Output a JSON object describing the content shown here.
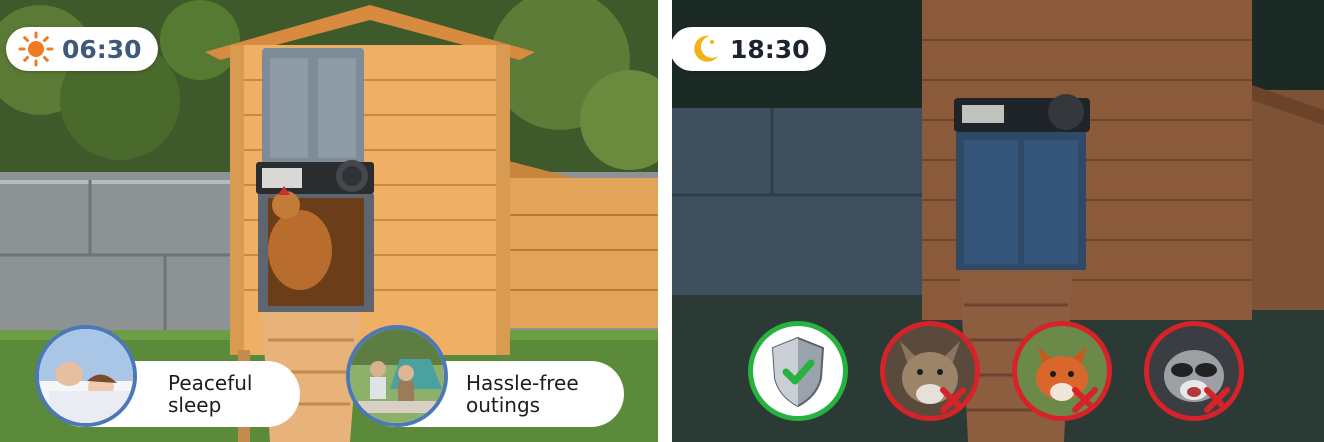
{
  "day_panel": {
    "time": "06:30",
    "time_icon": "sun-icon",
    "features": [
      {
        "label": "Peaceful\nsleep",
        "icon": "sleeping-couple-photo"
      },
      {
        "label": "Hassle-free\noutings",
        "icon": "family-picnic-photo"
      }
    ]
  },
  "night_panel": {
    "time": "18:30",
    "time_icon": "moon-icon",
    "badges": [
      {
        "name": "shield-check",
        "status": "allowed"
      },
      {
        "name": "wolf",
        "status": "blocked"
      },
      {
        "name": "fox",
        "status": "blocked"
      },
      {
        "name": "raccoon",
        "status": "blocked"
      }
    ]
  },
  "colors": {
    "time_day": "#3d5a7a",
    "sun": "#f07a22",
    "moon": "#f2b319",
    "avatar_ring": "#4d78b8",
    "badge_ok": "#27b23f",
    "badge_block": "#d8222a"
  }
}
